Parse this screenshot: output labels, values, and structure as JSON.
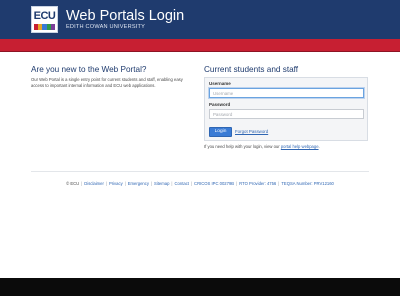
{
  "header": {
    "logo_text": "ECU",
    "logo_stripe_colors": [
      "#c71f32",
      "#e6a52a",
      "#3a7bd5",
      "#2f9a4a",
      "#7a3f98"
    ],
    "title": "Web Portals Login",
    "subtitle": "EDITH COWAN UNIVERSITY"
  },
  "intro": {
    "heading": "Are you new to the Web Portal?",
    "body": "Our Web Portal is a single entry point for current students and staff, enabling easy access to important internal information and ECU web applications."
  },
  "login": {
    "heading": "Current students and staff",
    "username_label": "Username",
    "username_placeholder": "Username",
    "username_value": "",
    "password_label": "Password",
    "password_placeholder": "Password",
    "password_value": "",
    "login_button": "Login",
    "forgot_link": "Forgot Password",
    "help_text": "If you need help with your login, view our",
    "help_link": "portal help webpage",
    "help_suffix": "."
  },
  "footer": {
    "copyright": "© ECU",
    "links": [
      "Disclaimer",
      "Privacy",
      "Emergency",
      "Sitemap",
      "Contact",
      "CRICOS IPC 00279B",
      "RTO Provider: 4756",
      "TEQSA Number: PRV12160"
    ]
  },
  "colors": {
    "brand_navy": "#1f3b6e",
    "brand_red": "#c71f32",
    "link_blue": "#2f66b3",
    "button_blue": "#3a7bd5"
  }
}
